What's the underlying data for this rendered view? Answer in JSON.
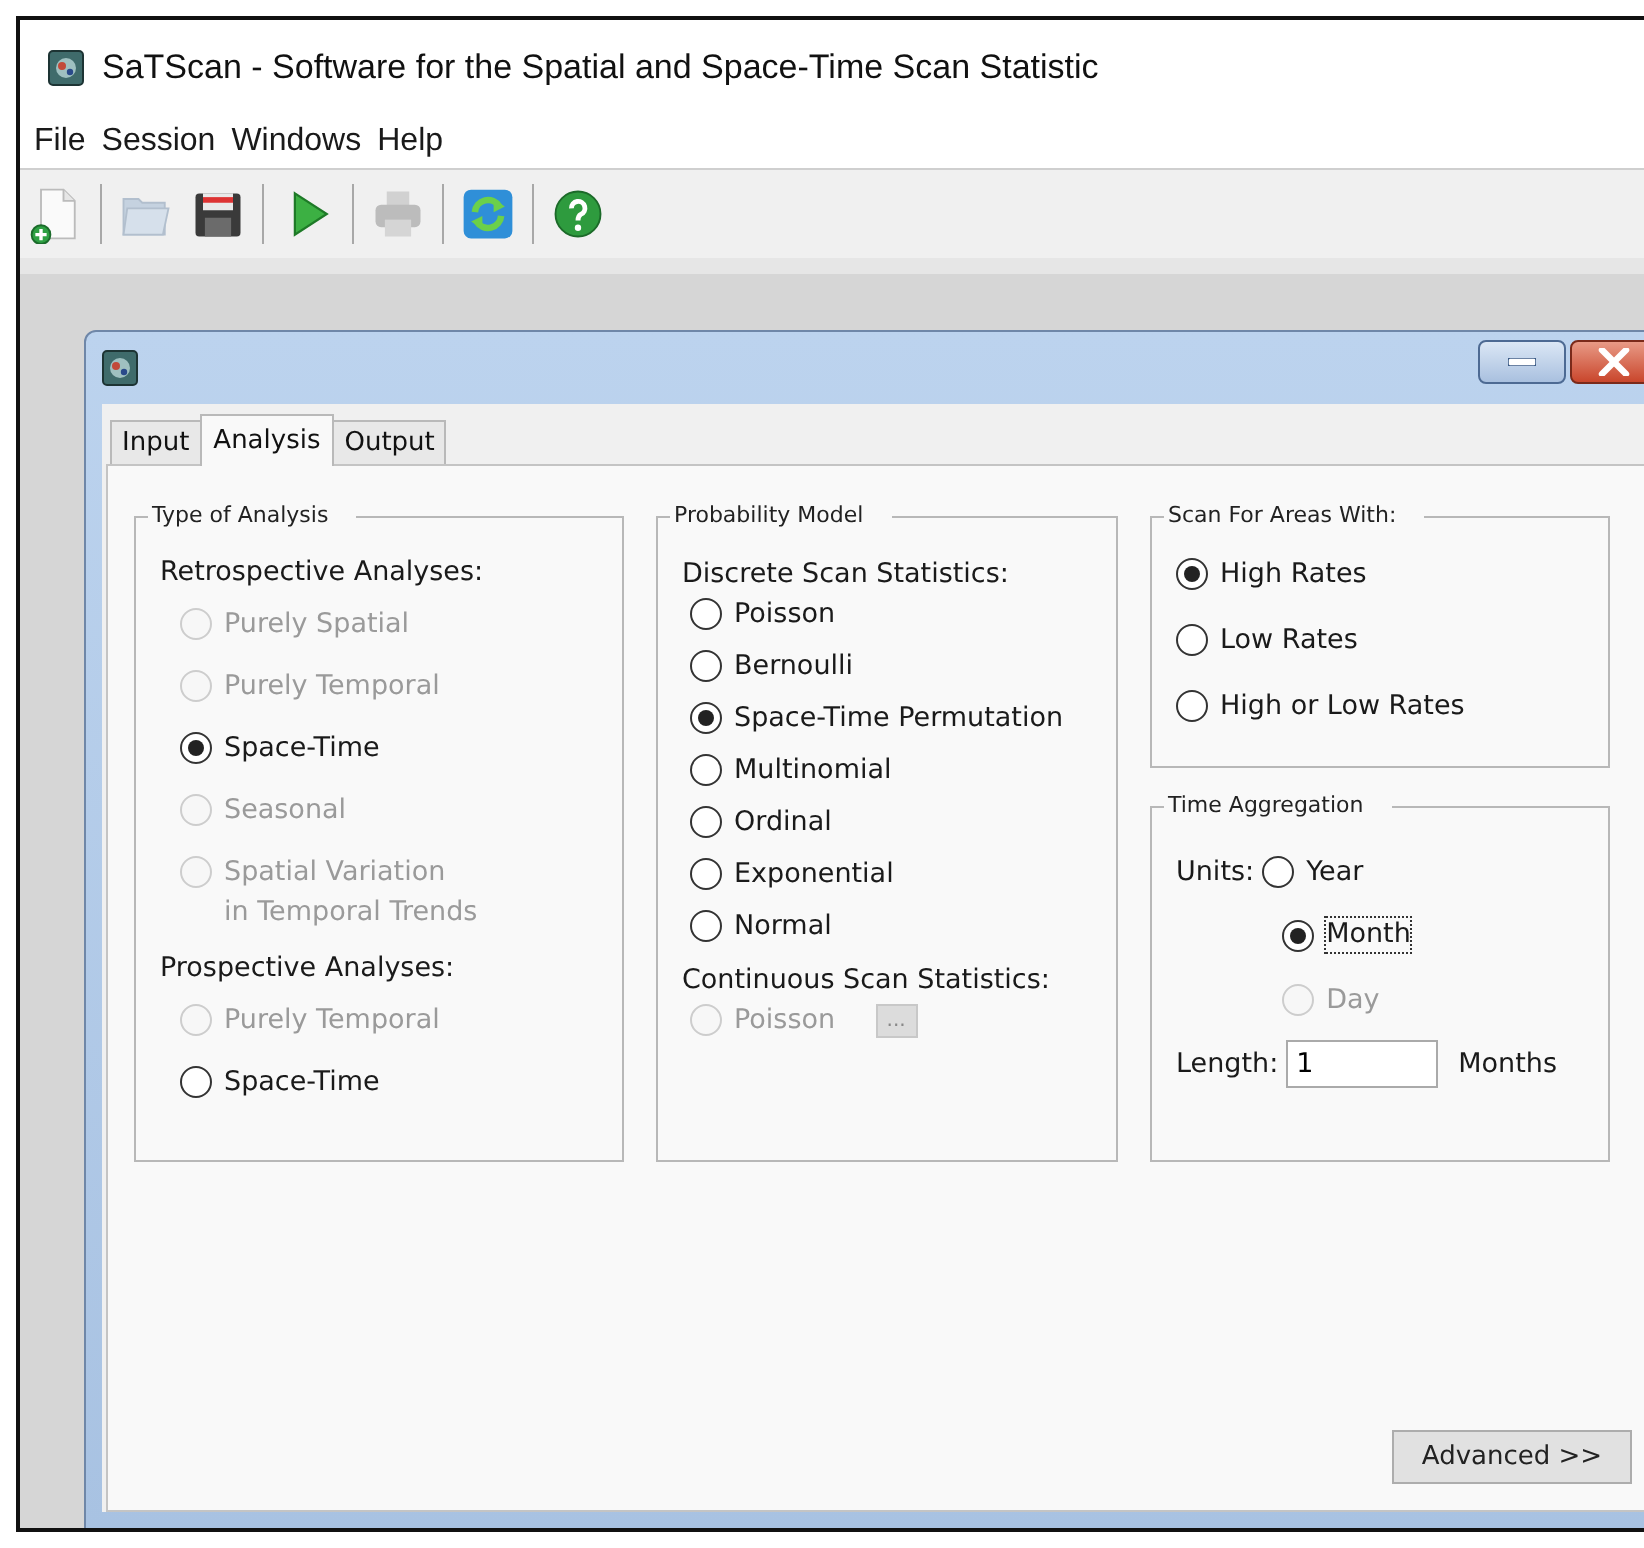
{
  "app": {
    "title": "SaTScan - Software for the Spatial and Space-Time Scan Statistic"
  },
  "menu": [
    "File",
    "Session",
    "Windows",
    "Help"
  ],
  "toolbar": [
    [
      {
        "kind": "new",
        "disabled": false
      }
    ],
    [
      {
        "kind": "open",
        "disabled": true
      },
      {
        "kind": "save",
        "disabled": false
      }
    ],
    [
      {
        "kind": "run",
        "disabled": false
      }
    ],
    [
      {
        "kind": "print",
        "disabled": true
      }
    ],
    [
      {
        "kind": "refresh",
        "disabled": false
      }
    ],
    [
      {
        "kind": "help",
        "disabled": false
      }
    ]
  ],
  "dialog": {
    "tabs": [
      {
        "label": "Input",
        "selected": false
      },
      {
        "label": "Analysis",
        "selected": true
      },
      {
        "label": "Output",
        "selected": false
      }
    ],
    "type_of_analysis": {
      "title": "Type of Analysis",
      "items": [
        {
          "kind": "heading",
          "label": "Retrospective Analyses:"
        },
        {
          "kind": "radio",
          "label": "Purely Spatial",
          "selected": false,
          "disabled": true
        },
        {
          "kind": "radio",
          "label": "Purely Temporal",
          "selected": false,
          "disabled": true
        },
        {
          "kind": "radio",
          "label": "Space-Time",
          "selected": true,
          "disabled": false
        },
        {
          "kind": "radio",
          "label": "Seasonal",
          "selected": false,
          "disabled": true
        },
        {
          "kind": "radio",
          "label": "Spatial Variation\nin Temporal Trends",
          "selected": false,
          "disabled": true
        },
        {
          "kind": "heading",
          "label": "Prospective Analyses:"
        },
        {
          "kind": "radio",
          "label": "Purely Temporal",
          "selected": false,
          "disabled": true
        },
        {
          "kind": "radio",
          "label": "Space-Time",
          "selected": false,
          "disabled": false
        }
      ]
    },
    "probability_model": {
      "title": "Probability Model",
      "items": [
        {
          "kind": "heading",
          "label": "Discrete Scan Statistics:"
        },
        {
          "kind": "radio",
          "label": "Poisson",
          "selected": false,
          "disabled": false
        },
        {
          "kind": "radio",
          "label": "Bernoulli",
          "selected": false,
          "disabled": false
        },
        {
          "kind": "radio",
          "label": "Space-Time Permutation",
          "selected": true,
          "disabled": false
        },
        {
          "kind": "radio",
          "label": "Multinomial",
          "selected": false,
          "disabled": false
        },
        {
          "kind": "radio",
          "label": "Ordinal",
          "selected": false,
          "disabled": false
        },
        {
          "kind": "radio",
          "label": "Exponential",
          "selected": false,
          "disabled": false
        },
        {
          "kind": "radio",
          "label": "Normal",
          "selected": false,
          "disabled": false
        },
        {
          "kind": "heading",
          "label": "Continuous Scan Statistics:"
        },
        {
          "kind": "radio",
          "label": "Poisson",
          "selected": false,
          "disabled": true,
          "button": "..."
        }
      ]
    },
    "scan_for_areas": {
      "title": "Scan For Areas With:",
      "items": [
        {
          "kind": "radio",
          "label": "High Rates",
          "selected": true,
          "disabled": false
        },
        {
          "kind": "radio",
          "label": "Low Rates",
          "selected": false,
          "disabled": false
        },
        {
          "kind": "radio",
          "label": "High or Low Rates",
          "selected": false,
          "disabled": false
        }
      ]
    },
    "time_aggregation": {
      "title": "Time Aggregation",
      "units_label": "Units:",
      "units": [
        {
          "label": "Year",
          "selected": false,
          "disabled": false,
          "focused": false
        },
        {
          "label": "Month",
          "selected": true,
          "disabled": false,
          "focused": true
        },
        {
          "label": "Day",
          "selected": false,
          "disabled": true,
          "focused": false
        }
      ],
      "length_label": "Length:",
      "length_value": "1",
      "length_unit": "Months"
    },
    "advanced_button": "Advanced >>"
  }
}
